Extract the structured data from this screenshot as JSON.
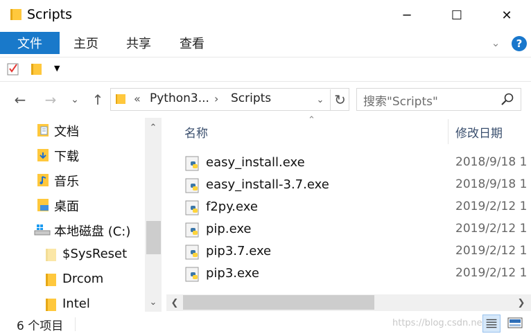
{
  "window": {
    "title": "Scripts",
    "controls": {
      "minimize": "─",
      "maximize": "☐",
      "close": "✕"
    }
  },
  "ribbon": {
    "tabs": [
      {
        "label": "文件",
        "active": true
      },
      {
        "label": "主页"
      },
      {
        "label": "共享"
      },
      {
        "label": "查看"
      }
    ],
    "help_label": "?"
  },
  "quick_access": {
    "icons": [
      "properties-icon",
      "new-folder-icon",
      "customize-dropdown-icon"
    ]
  },
  "navigation": {
    "address": {
      "overflow_chevron": "«",
      "crumbs": [
        "Python3...",
        "Scripts"
      ],
      "separator": "›"
    },
    "search": {
      "placeholder": "搜索\"Scripts\""
    }
  },
  "sidebar": {
    "items": [
      {
        "label": "文档",
        "icon": "documents-folder-icon"
      },
      {
        "label": "下载",
        "icon": "downloads-folder-icon"
      },
      {
        "label": "音乐",
        "icon": "music-folder-icon"
      },
      {
        "label": "桌面",
        "icon": "desktop-folder-icon"
      },
      {
        "label": "本地磁盘 (C:)",
        "icon": "local-disk-icon"
      },
      {
        "label": "$SysReset",
        "icon": "folder-icon"
      },
      {
        "label": "Drcom",
        "icon": "folder-icon"
      },
      {
        "label": "Intel",
        "icon": "folder-icon"
      }
    ]
  },
  "file_list": {
    "columns": {
      "name": "名称",
      "date": "修改日期"
    },
    "files": [
      {
        "name": "easy_install.exe",
        "date": "2018/9/18 1"
      },
      {
        "name": "easy_install-3.7.exe",
        "date": "2018/9/18 1"
      },
      {
        "name": "f2py.exe",
        "date": "2019/2/12 1"
      },
      {
        "name": "pip.exe",
        "date": "2019/2/12 1"
      },
      {
        "name": "pip3.7.exe",
        "date": "2019/2/12 1"
      },
      {
        "name": "pip3.exe",
        "date": "2019/2/12 1"
      }
    ]
  },
  "status": {
    "item_count": "6 个项目",
    "watermark": "https://blog.csdn.net/..."
  },
  "colors": {
    "accent": "#1979ca",
    "folder_yellow": "#ffc83d",
    "header_text": "#3a4f6e"
  }
}
